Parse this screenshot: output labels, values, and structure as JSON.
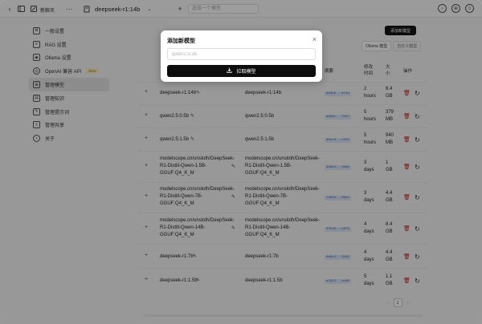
{
  "topbar": {
    "new_chat": "新聊天",
    "model": "deepseek-r1:14b",
    "compare_placeholder": "选择一个模型"
  },
  "sidebar": {
    "items": [
      {
        "label": "一般设置",
        "icon": "settings-icon"
      },
      {
        "label": "RAG 设置",
        "icon": "document-icon"
      },
      {
        "label": "Ollama 设置",
        "icon": "ollama-icon"
      },
      {
        "label": "OpenAI 兼容 API",
        "icon": "api-icon",
        "badge": "Beta"
      },
      {
        "label": "管理模型",
        "icon": "models-icon",
        "active": true
      },
      {
        "label": "管理知识",
        "icon": "knowledge-icon"
      },
      {
        "label": "管理提示词",
        "icon": "prompt-icon"
      },
      {
        "label": "管理共享",
        "icon": "share-icon"
      },
      {
        "label": "关于",
        "icon": "info-icon"
      }
    ]
  },
  "main": {
    "add_model_button": "添加新模型",
    "tabs": [
      "Ollama 模型",
      "自定义模型"
    ],
    "columns": {
      "digest": "摘要",
      "modified": "修改时间",
      "size": "大小",
      "action": "操作"
    },
    "rows": [
      {
        "name": [
          "deepseek-r1:14b"
        ],
        "model": [
          "deepseek-r1:14b"
        ],
        "digest": "ea3b8...4f1a",
        "modified": [
          "2",
          "hours"
        ],
        "size": [
          "8.4",
          "GB"
        ]
      },
      {
        "name": [
          "qwen2.5:0.5b"
        ],
        "model": [
          "qwen2.5:0.5b"
        ],
        "digest": "a8b0c...7c67",
        "modified": [
          "5",
          "hours"
        ],
        "size": [
          "379",
          "MB"
        ]
      },
      {
        "name": [
          "qwen2.5:1.5b"
        ],
        "model": [
          "qwen2.5:1.5b"
        ],
        "digest": "65ec6...c57b",
        "modified": [
          "5",
          "hours"
        ],
        "size": [
          "940",
          "MB"
        ]
      },
      {
        "name": [
          "modelscope.cn/unsloth/DeepSeek-",
          "R1-Distill-Qwen-1.5B-",
          "GGUF:Q4_K_M"
        ],
        "model": [
          "modelscope.cn/unsloth/DeepSeek-",
          "R1-Distill-Qwen-1.5B-",
          "GGUF:Q4_K_M"
        ],
        "digest": "39884...d0a9",
        "modified": [
          "3",
          "days"
        ],
        "size": [
          "1",
          "GB"
        ]
      },
      {
        "name": [
          "modelscope.cn/unsloth/DeepSeek-",
          "R1-Distill-Qwen-7B-",
          "GGUF:Q4_K_M"
        ],
        "model": [
          "modelscope.cn/unsloth/DeepSeek-",
          "R1-Distill-Qwen-7B-",
          "GGUF:Q4_K_M"
        ],
        "digest": "fd62d...8be4",
        "modified": [
          "3",
          "days"
        ],
        "size": [
          "4.4",
          "GB"
        ]
      },
      {
        "name": [
          "modelscope.cn/unsloth/DeepSeek-",
          "R1-Distill-Qwen-14B-",
          "GGUF:Q4_K_M"
        ],
        "model": [
          "modelscope.cn/unsloth/DeepSeek-",
          "R1-Distill-Qwen-14B-",
          "GGUF:Q4_K_M"
        ],
        "digest": "07b28...b0f3",
        "modified": [
          "4",
          "days"
        ],
        "size": [
          "8.4",
          "GB"
        ]
      },
      {
        "name": [
          "deepseek-r1:7b"
        ],
        "model": [
          "deepseek-r1:7b"
        ],
        "digest": "0a8c2...3163",
        "modified": [
          "4",
          "days"
        ],
        "size": [
          "4.4",
          "GB"
        ]
      },
      {
        "name": [
          "deepseek-r1:1.5b"
        ],
        "model": [
          "deepseek-r1:1.5b"
        ],
        "digest": "a42b2...ac98",
        "modified": [
          "5",
          "days"
        ],
        "size": [
          "1.1",
          "GB"
        ]
      }
    ],
    "pagination": {
      "current": "1"
    }
  },
  "modal": {
    "title": "添加新模型",
    "input_placeholder": "qwen2.5:3b",
    "pull_button": "拉取模型",
    "close": "×"
  },
  "icons": {
    "sidebar_toggle": "sidebar-toggle-icon",
    "back": "back-arrow-icon",
    "edit": "edit-icon",
    "more": "more-icon",
    "model_box": "model-box-icon",
    "bell": "bell-icon",
    "globe": "globe-icon",
    "user": "user-avatar-icon",
    "delete": "trash-icon",
    "update": "refresh-icon",
    "download": "download-icon"
  },
  "colors": {
    "accent": "#151515",
    "delete": "#c02020",
    "digest_bg": "#dbe6f7",
    "beta_bg": "#fbf0c8"
  }
}
